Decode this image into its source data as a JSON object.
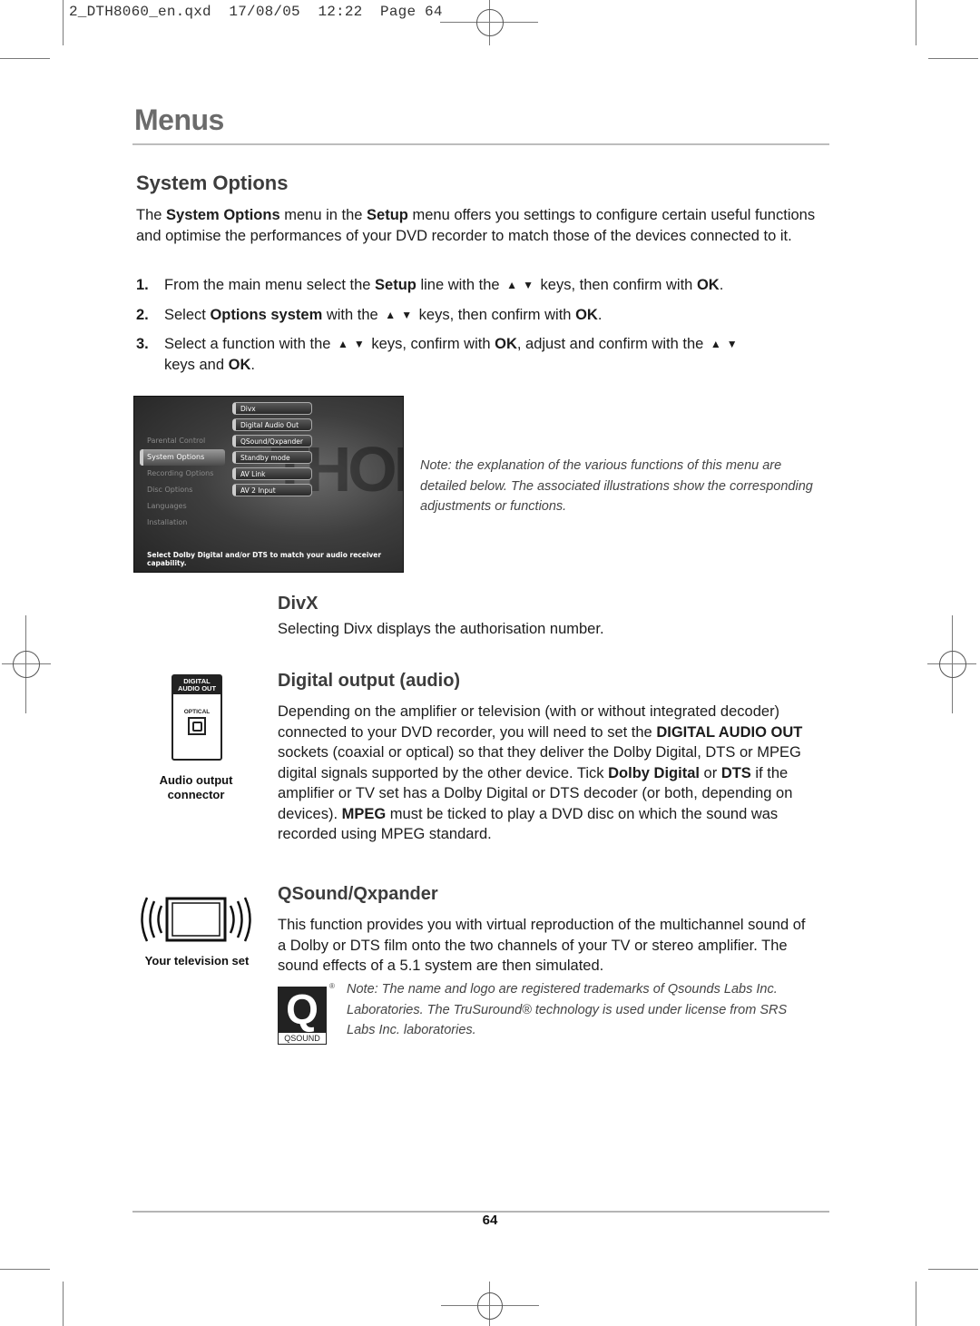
{
  "slug": "2_DTH8060_en.qxd  17/08/05  12:22  Page 64",
  "page_title": "Menus",
  "section": {
    "title": "System Options",
    "intro": {
      "t1": "The ",
      "b1": "System Options",
      "t2": " menu in the ",
      "b2": "Setup",
      "t3": " menu offers you settings to configure certain useful functions and optimise the performances of your DVD recorder to match those of the devices connected to it."
    },
    "steps": [
      {
        "num": "1.",
        "t1": "From the main menu select the ",
        "b1": "Setup",
        "t2": " line with the ",
        "t3": " keys, then confirm with ",
        "b2": "OK",
        "t4": "."
      },
      {
        "num": "2.",
        "t1": "Select ",
        "b1": "Options system",
        "t2": " with the ",
        "t3": " keys, then confirm with ",
        "b2": "OK",
        "t4": "."
      },
      {
        "num": "3.",
        "t1": "Select a function with the ",
        "t2": " keys, confirm with ",
        "b1": "OK",
        "t3": ", adjust and confirm with the ",
        "t4": " keys and ",
        "b2": "OK",
        "t5": "."
      }
    ],
    "arrow_up": "▲",
    "arrow_down": "▼"
  },
  "osd": {
    "watermark": "THOMSON",
    "left_menu": [
      "",
      "",
      "Parental Control",
      "System Options",
      "Recording Options",
      "Disc Options",
      "Languages",
      "Installation"
    ],
    "right_menu": [
      "Divx",
      "Digital Audio Out",
      "QSound/Qxpander",
      "Standby mode",
      "AV Link",
      "AV 2 Input"
    ],
    "hint": "Select Dolby Digital and/or DTS to match your audio receiver capability."
  },
  "note_top": "Note: the explanation of the various functions of this menu are detailed below. The associated illustrations show the corresponding adjustments or functions.",
  "divx": {
    "title": "DivX",
    "body": "Selecting Divx displays the authorisation number."
  },
  "digital_output": {
    "title": "Digital output (audio)",
    "icon": {
      "head_line1": "DIGITAL",
      "head_line2": "AUDIO OUT",
      "port_label": "OPTICAL"
    },
    "caption_line1": "Audio output",
    "caption_line2": "connector",
    "body": {
      "t1": "Depending on the amplifier or television (with or without integrated decoder) connected to your DVD recorder, you will need to set the ",
      "b1": "DIGITAL AUDIO OUT",
      "t2": " sockets (coaxial or optical) so that they deliver the Dolby Digital, DTS or MPEG digital signals supported by the other device. Tick ",
      "b2": "Dolby Digital",
      "t3": " or ",
      "b3": "DTS",
      "t4": " if the amplifier or TV set has a Dolby Digital or DTS decoder (or both, depending on devices). ",
      "b4": "MPEG",
      "t5": " must be ticked to play a DVD disc on which the sound was recorded using MPEG standard."
    }
  },
  "qsound": {
    "title": "QSound/Qxpander",
    "caption": "Your television set",
    "body": "This function provides you with virtual reproduction of the multichannel sound of a Dolby or DTS film onto the two channels of your TV or stereo amplifier. The sound effects of a 5.1 system are then simulated.",
    "logo_letter": "Q",
    "logo_label": "QSOUND",
    "registered": "®",
    "note": "Note: The name and logo are registered trademarks of Qsounds Labs Inc. Laboratories. The TruSuround® technology is used under license from SRS Labs Inc. laboratories."
  },
  "page_number": "64"
}
